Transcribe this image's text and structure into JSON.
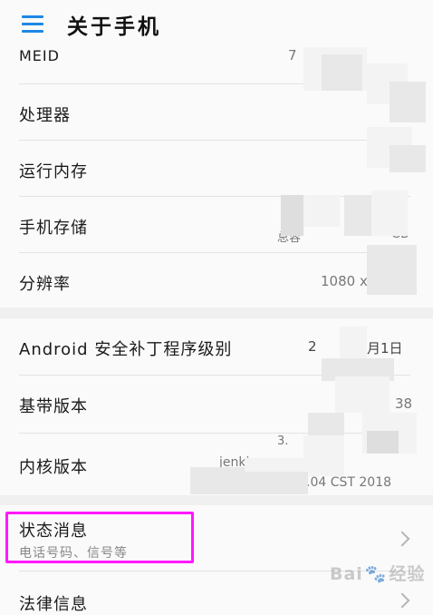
{
  "header": {
    "title": "关于手机"
  },
  "rows": {
    "meid": {
      "label": "MEID",
      "value": "7"
    },
    "processor": {
      "label": "处理器"
    },
    "ram": {
      "label": "运行内存"
    },
    "storage": {
      "label": "手机存储",
      "value_left": "总容",
      "value_right": "GB"
    },
    "resolution": {
      "label": "分辨率",
      "value": "1080 x 1"
    },
    "security_patch": {
      "label": "Android 安全补丁程序级别",
      "value_left": "2",
      "value_right": "月1日"
    },
    "baseband": {
      "label": "基带版本",
      "value": "38"
    },
    "kernel": {
      "label": "内核版本",
      "value_top": "3.",
      "value_mid": "jenki",
      "value_bottom": ".04 CST 2018"
    },
    "status": {
      "label": "状态消息",
      "sublabel": "电话号码、信号等"
    },
    "legal": {
      "label": "法律信息"
    }
  },
  "watermark": {
    "text": "Bai",
    "text2": "经验"
  }
}
